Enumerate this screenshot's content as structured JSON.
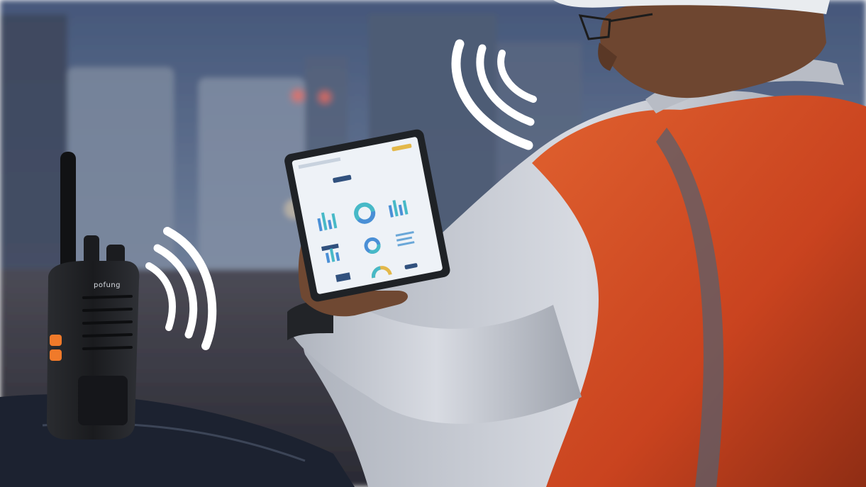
{
  "scene": {
    "description_tag": "photo",
    "radio": {
      "brand_text": "pofung"
    },
    "tablet": {
      "chart_dots": [
        {
          "color": "#4a8fd6"
        },
        {
          "color": "#47b9c7"
        },
        {
          "color": "#e3b84a"
        }
      ]
    },
    "colors": {
      "sky": "#5b6f8c",
      "plant": "#6b7a92",
      "vest": "#d9512b",
      "vest_dark": "#8a2f17",
      "shirt": "#c9ccd3",
      "skin": "#7a4e35",
      "radio": "#1d1f22",
      "radio_button": "#f07a2a",
      "signal": "#ffffff",
      "tablet_frame": "#1f2226",
      "tablet_screen": "#eef2f7"
    }
  }
}
